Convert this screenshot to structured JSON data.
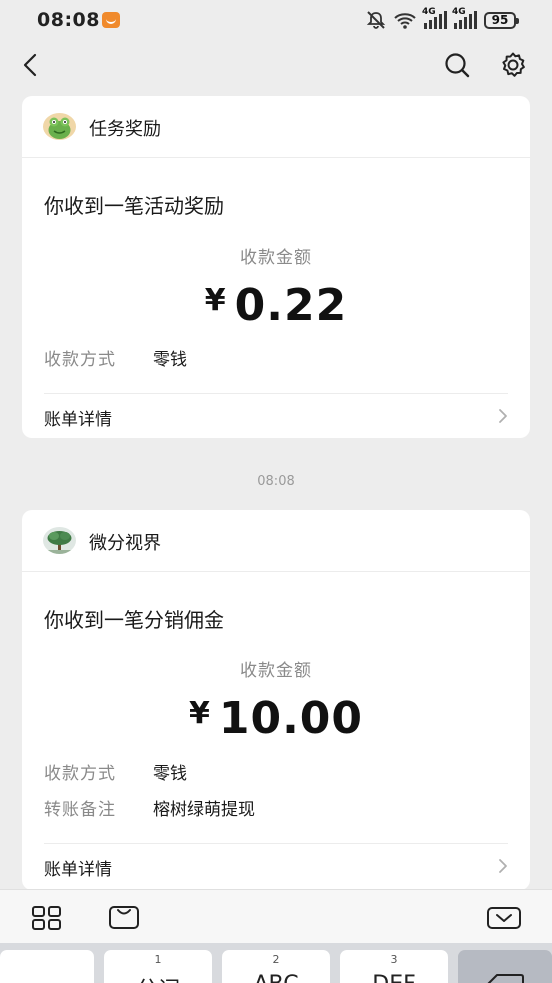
{
  "status_bar": {
    "time": "08:08",
    "battery": "95",
    "net1": "4G",
    "net2": "4G"
  },
  "nav": {
    "title": ""
  },
  "cards": [
    {
      "sender": "任务奖励",
      "headline": "你收到一笔活动奖励",
      "amount_label": "收款金额",
      "currency": "¥",
      "amount": "0.22",
      "rows": [
        {
          "key": "收款方式",
          "value": "零钱"
        }
      ],
      "detail_label": "账单详情"
    },
    {
      "sender": "微分视界",
      "headline": "你收到一笔分销佣金",
      "amount_label": "收款金额",
      "currency": "¥",
      "amount": "10.00",
      "rows": [
        {
          "key": "收款方式",
          "value": "零钱"
        },
        {
          "key": "转账备注",
          "value": "榕树绿萌提现"
        }
      ],
      "detail_label": "账单详情"
    }
  ],
  "timestamp": "08:08",
  "keyboard": {
    "keys": [
      {
        "num": "",
        "main": ","
      },
      {
        "num": "1",
        "main": "分词"
      },
      {
        "num": "2",
        "main": "ABC"
      },
      {
        "num": "3",
        "main": "DEF"
      }
    ]
  }
}
